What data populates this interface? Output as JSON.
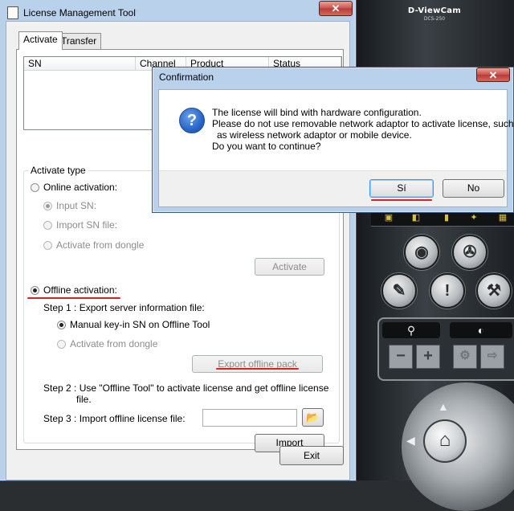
{
  "camera_panel": {
    "brand": "D-ViewCam",
    "model": "DCS-250",
    "buttons": [
      "record-icon",
      "film-reel-icon",
      "settings-tool-icon",
      "alert-icon",
      "wrench-icon"
    ]
  },
  "main_window": {
    "title": "License Management Tool",
    "close_glyph": "✕",
    "tabs": [
      {
        "label": "Activate"
      },
      {
        "label": "Transfer"
      }
    ],
    "list_columns": [
      "SN",
      "Channel",
      "Product",
      "Status"
    ],
    "group_title": "Activate type",
    "online_activation": {
      "label": "Online activation:",
      "options": [
        "Input SN:",
        "Import SN file:",
        "Activate from dongle"
      ],
      "activate_button": "Activate"
    },
    "offline_activation": {
      "label": "Offline activation:",
      "step1": "Step 1 : Export server information file:",
      "step1_options": [
        "Manual key-in SN on Offline Tool",
        "Activate from dongle"
      ],
      "export_button": "Export offline pack",
      "step2_line1": "Step 2 : Use \"Offline Tool\" to activate license and get offline license",
      "step2_line2": "file.",
      "step3": "Step 3 : Import offline license file:",
      "import_file_value": "",
      "import_button": "Import"
    },
    "exit_button": "Exit"
  },
  "dialog": {
    "title": "Confirmation",
    "close_glyph": "✕",
    "icon": "question-icon",
    "message_lines": [
      "The license will bind with hardware configuration.",
      "Please do not use removable network adaptor to activate license, such",
      "as wireless network adaptor or mobile device.",
      "Do you want to continue?"
    ],
    "yes_button": "Sí",
    "no_button": "No"
  },
  "colors": {
    "annotation_red": "#e02020",
    "accent_blue": "#3399ff"
  }
}
